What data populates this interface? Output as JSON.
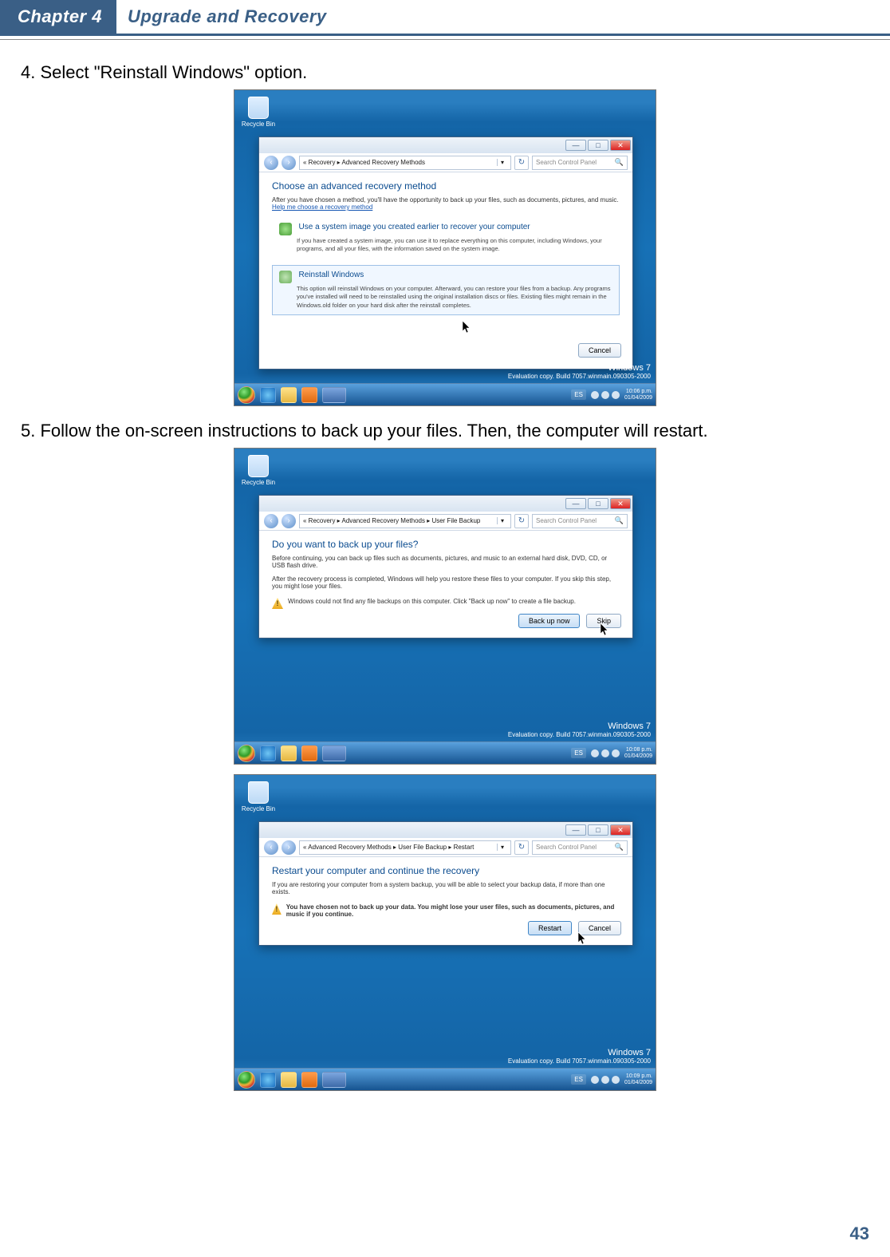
{
  "header": {
    "chapter": "Chapter 4",
    "title": "Upgrade and Recovery"
  },
  "steps": {
    "s4": "4. Select \"Reinstall Windows\" option.",
    "s5": "5. Follow the on-screen instructions to back up your files. Then, the computer will restart."
  },
  "common": {
    "recycle_bin": "Recycle Bin",
    "search_placeholder": "Search Control Panel",
    "lang": "ES",
    "time1": "10:06 p.m.",
    "date1": "01/04/2009",
    "time2": "10:08 p.m.",
    "date2": "01/04/2009",
    "time3": "10:09 p.m.",
    "date3": "01/04/2009",
    "eval_title": "Windows 7",
    "eval_sub": "Evaluation copy. Build 7057.winmain.090305-2000"
  },
  "dlg1": {
    "breadcrumb": "« Recovery ▸ Advanced Recovery Methods",
    "h": "Choose an advanced recovery method",
    "sub": "After you have chosen a method, you'll have the opportunity to back up your files, such as documents, pictures, and music.",
    "link": "Help me choose a recovery method",
    "opt1_title": "Use a system image you created earlier to recover your computer",
    "opt1_desc": "If you have created a system image, you can use it to replace everything on this computer, including Windows, your programs, and all your files, with the information saved on the system image.",
    "opt2_title": "Reinstall Windows",
    "opt2_desc": "This option will reinstall Windows on your computer. Afterward, you can restore your files from a backup. Any programs you've installed will need to be reinstalled using the original installation discs or files. Existing files might remain in the Windows.old folder on your hard disk after the reinstall completes.",
    "cancel": "Cancel"
  },
  "dlg2": {
    "breadcrumb": "« Recovery ▸ Advanced Recovery Methods ▸ User File Backup",
    "h": "Do you want to back up your files?",
    "p1": "Before continuing, you can back up files such as documents, pictures, and music to an external hard disk, DVD, CD, or USB flash drive.",
    "p2": "After the recovery process is completed, Windows will help you restore these files to your computer. If you skip this step, you might lose your files.",
    "warn": "Windows could not find any file backups on this computer. Click \"Back up now\" to create a file backup.",
    "backup": "Back up now",
    "skip": "Skip"
  },
  "dlg3": {
    "breadcrumb": "« Advanced Recovery Methods ▸ User File Backup ▸ Restart",
    "h": "Restart your computer and continue the recovery",
    "p1": "If you are restoring your computer from a system backup, you will be able to select your backup data, if more than one exists.",
    "warn": "You have chosen not to back up your data. You might lose your user files, such as documents, pictures, and music if you continue.",
    "restart": "Restart",
    "cancel": "Cancel"
  },
  "page_number": "43"
}
